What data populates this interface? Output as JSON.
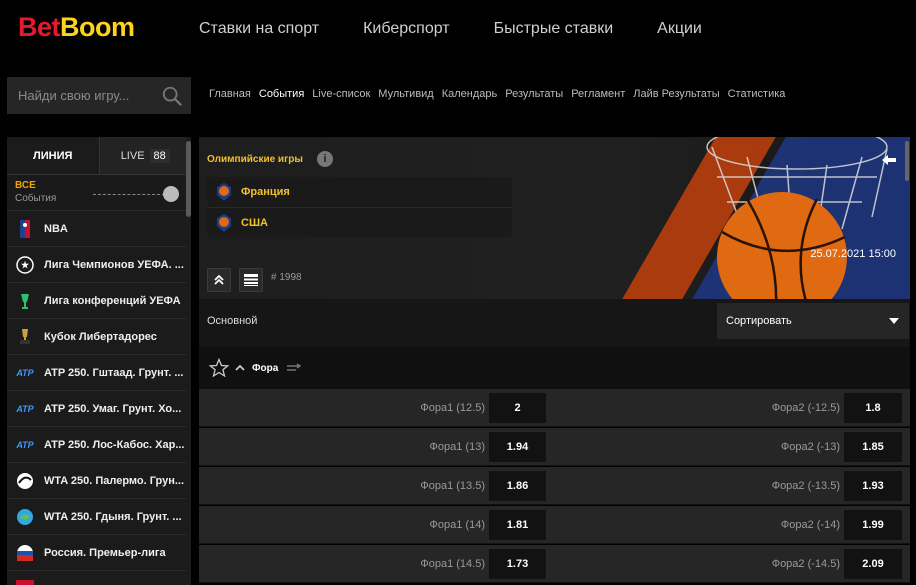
{
  "brand": {
    "part1": "Bet",
    "part2": "Boom"
  },
  "top_nav": [
    "Ставки на спорт",
    "Киберспорт",
    "Быстрые ставки",
    "Акции"
  ],
  "search": {
    "placeholder": "Найди свою игру..."
  },
  "sub_nav": {
    "items": [
      "Главная",
      "События",
      "Live-список",
      "Мультивид",
      "Календарь",
      "Результаты",
      "Регламент",
      "Лайв Результаты",
      "Статистика"
    ],
    "active": "События"
  },
  "sidebar": {
    "tabs": {
      "line": "ЛИНИЯ",
      "live": "LIVE",
      "live_count": "88"
    },
    "all": {
      "title": "ВСЕ",
      "subtitle": "События"
    },
    "items": [
      {
        "label": "NBA",
        "icon": "nba-icon"
      },
      {
        "label": "Лига Чемпионов УЕФА. ...",
        "icon": "ucl-icon"
      },
      {
        "label": "Лига конференций УЕФА",
        "icon": "uecl-icon"
      },
      {
        "label": "Кубок Либертадорес",
        "icon": "libertadores-icon"
      },
      {
        "label": "ATP 250. Гштаад. Грунт. ...",
        "icon": "atp-icon"
      },
      {
        "label": "ATP 250. Умаг. Грунт. Хо...",
        "icon": "atp-icon"
      },
      {
        "label": "ATP 250. Лос-Кабос. Хар...",
        "icon": "atp-icon"
      },
      {
        "label": "WTA 250. Палермо. Грун...",
        "icon": "wta-icon"
      },
      {
        "label": "WTA 250. Гдыня. Грунт. ...",
        "icon": "wta-icon"
      },
      {
        "label": "Россия. Премьер-лига",
        "icon": "rpl-icon"
      },
      {
        "label": "",
        "icon": "league-icon"
      }
    ]
  },
  "event": {
    "league": "Олимпийские игры",
    "team1": "Франция",
    "team2": "США",
    "datetime": "25.07.2021  15:00",
    "game_id": "# 1998"
  },
  "filter": {
    "main": "Основной",
    "sort": "Сортировать"
  },
  "market": {
    "name": "Фора",
    "rows": [
      {
        "l_label": "Фора1 (12.5)",
        "l_odd": "2",
        "r_label": "Фора2 (-12.5)",
        "r_odd": "1.8"
      },
      {
        "l_label": "Фора1 (13)",
        "l_odd": "1.94",
        "r_label": "Фора2 (-13)",
        "r_odd": "1.85"
      },
      {
        "l_label": "Фора1 (13.5)",
        "l_odd": "1.86",
        "r_label": "Фора2 (-13.5)",
        "r_odd": "1.93"
      },
      {
        "l_label": "Фора1 (14)",
        "l_odd": "1.81",
        "r_label": "Фора2 (-14)",
        "r_odd": "1.99"
      },
      {
        "l_label": "Фора1 (14.5)",
        "l_odd": "1.73",
        "r_label": "Фора2 (-14.5)",
        "r_odd": "2.09"
      }
    ]
  },
  "colors": {
    "accent": "#f3c12b",
    "brand_red": "#e8192c",
    "brand_yellow": "#ffd21e",
    "orange": "#e8600a"
  }
}
